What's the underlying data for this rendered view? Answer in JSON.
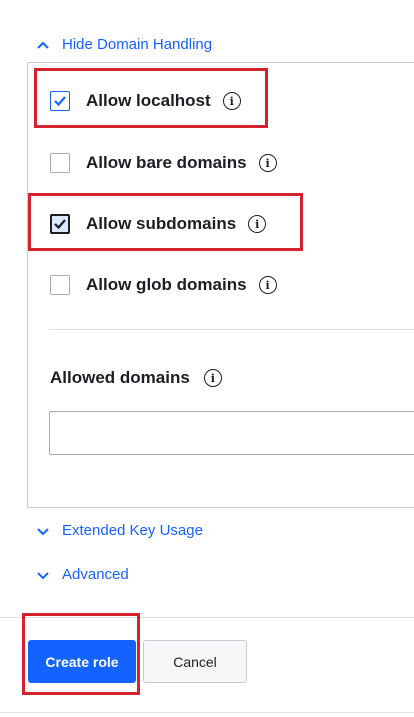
{
  "sections": {
    "domain_handling_toggle": "Hide Domain Handling",
    "extended_key_usage_toggle": "Extended Key Usage",
    "advanced_toggle": "Advanced"
  },
  "options": [
    {
      "label": "Allow localhost",
      "checked": true
    },
    {
      "label": "Allow bare domains",
      "checked": false
    },
    {
      "label": "Allow subdomains",
      "checked": true
    },
    {
      "label": "Allow glob domains",
      "checked": false
    }
  ],
  "allowed_domains": {
    "label": "Allowed domains",
    "value": ""
  },
  "info_icon": "i",
  "buttons": {
    "create": "Create role",
    "cancel": "Cancel"
  },
  "colors": {
    "accent": "#1563ff",
    "highlight": "#d4232f",
    "text": "#1d1e23"
  }
}
